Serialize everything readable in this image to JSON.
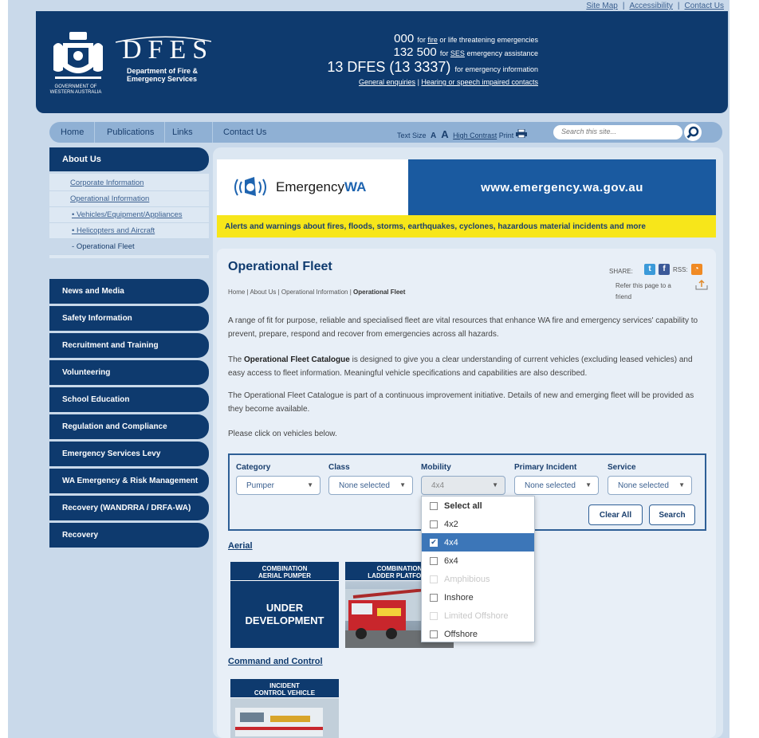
{
  "top_links": [
    "Site Map",
    "Accessibility",
    "Contact Us"
  ],
  "header": {
    "logo_text": "DFES",
    "logo_sub_1": "Department of Fire &",
    "logo_sub_2": "Emergency Services",
    "gov_1": "GOVERNMENT OF",
    "gov_2": "WESTERN AUSTRALIA",
    "line1_num": "000",
    "line1_pre": "for",
    "line1_link": "fire",
    "line1_post": "or life threatening emergencies",
    "line2_num": "132 500",
    "line2_pre": "for",
    "line2_link": "SES",
    "line2_post": "emergency assistance",
    "line3_num": "13 DFES (13 3337)",
    "line3_post": "for emergency information",
    "link_general": "General enquiries",
    "link_sep": "|",
    "link_hearing": "Hearing or speech impaired contacts"
  },
  "nav": {
    "home": "Home",
    "publications": "Publications",
    "links": "Links",
    "contact": "Contact Us",
    "text_size": "Text Size",
    "a_small": "A",
    "a_big": "A",
    "high_contrast": "High Contrast",
    "print": "Print",
    "search_placeholder": "Search this site..."
  },
  "sidebar": {
    "about": "About Us",
    "sub": [
      {
        "label": "Corporate Information"
      },
      {
        "label": "Operational Information"
      },
      {
        "label": "Vehicles/Equipment/Appliances"
      },
      {
        "label": "Helicopters and Aircraft"
      },
      {
        "label": "Operational Fleet"
      }
    ],
    "cats": [
      "News and Media",
      "Safety Information",
      "Recruitment and Training",
      "Volunteering",
      "School Education",
      "Regulation and Compliance",
      "Emergency Services Levy",
      "WA Emergency & Risk Management",
      "Recovery (WANDRRA / DRFA-WA)",
      "Recovery"
    ]
  },
  "banner": {
    "brand_pre": "Emergency",
    "brand_bold": "WA",
    "url": "www.emergency.wa.gov.au",
    "strip": "Alerts and warnings about fires, floods, storms, earthquakes, cyclones, hazardous material incidents and more"
  },
  "content": {
    "title": "Operational Fleet",
    "bc_home": "Home",
    "bc_about": "About Us",
    "bc_opinfo": "Operational Information",
    "bc_current": "Operational Fleet",
    "bc_sep": "|",
    "share_label": "SHARE:",
    "rss_label": "RSS:",
    "refer": "Refer this page to a friend",
    "p1": "A range of fit for purpose, reliable and specialised fleet are vital resources that enhance WA fire and emergency services' capability to prevent, prepare, respond and recover from emergencies across all hazards.",
    "p2_pre": "The",
    "p2_bold": "Operational Fleet Catalogue",
    "p2_post": "is designed to give you a clear understanding of current vehicles (excluding leased vehicles) and easy access to fleet information. Meaningful vehicle specifications and capabilities are also described.",
    "p3": "The Operational Fleet Catalogue is part of a continuous improvement initiative. Details of new and emerging fleet will be provided as they become available.",
    "p4": "Please click on vehicles below."
  },
  "filters": {
    "category_label": "Category",
    "category_value": "Pumper",
    "class_label": "Class",
    "class_value": "None selected",
    "mobility_label": "Mobility",
    "mobility_value": "4x4",
    "incident_label": "Primary Incident",
    "incident_value": "None selected",
    "service_label": "Service",
    "service_value": "None selected",
    "clear_label": "Clear All",
    "search_label": "Search",
    "options": [
      {
        "label": "Select all",
        "state": "bold"
      },
      {
        "label": "4x2",
        "state": "normal"
      },
      {
        "label": "4x4",
        "state": "selected"
      },
      {
        "label": "6x4",
        "state": "normal"
      },
      {
        "label": "Amphibious",
        "state": "disabled"
      },
      {
        "label": "Inshore",
        "state": "normal"
      },
      {
        "label": "Limited Offshore",
        "state": "disabled"
      },
      {
        "label": "Offshore",
        "state": "normal"
      }
    ]
  },
  "fleet": {
    "aerial": "Aerial",
    "card1_t1": "COMBINATION",
    "card1_t2": "AERIAL PUMPER",
    "card1_body_1": "UNDER",
    "card1_body_2": "DEVELOPMENT",
    "card2_t1": "COMBINATION",
    "card2_t2": "LADDER PLATFORM",
    "command": "Command and Control",
    "card3_t1": "INCIDENT",
    "card3_t2": "CONTROL VEHICLE"
  }
}
